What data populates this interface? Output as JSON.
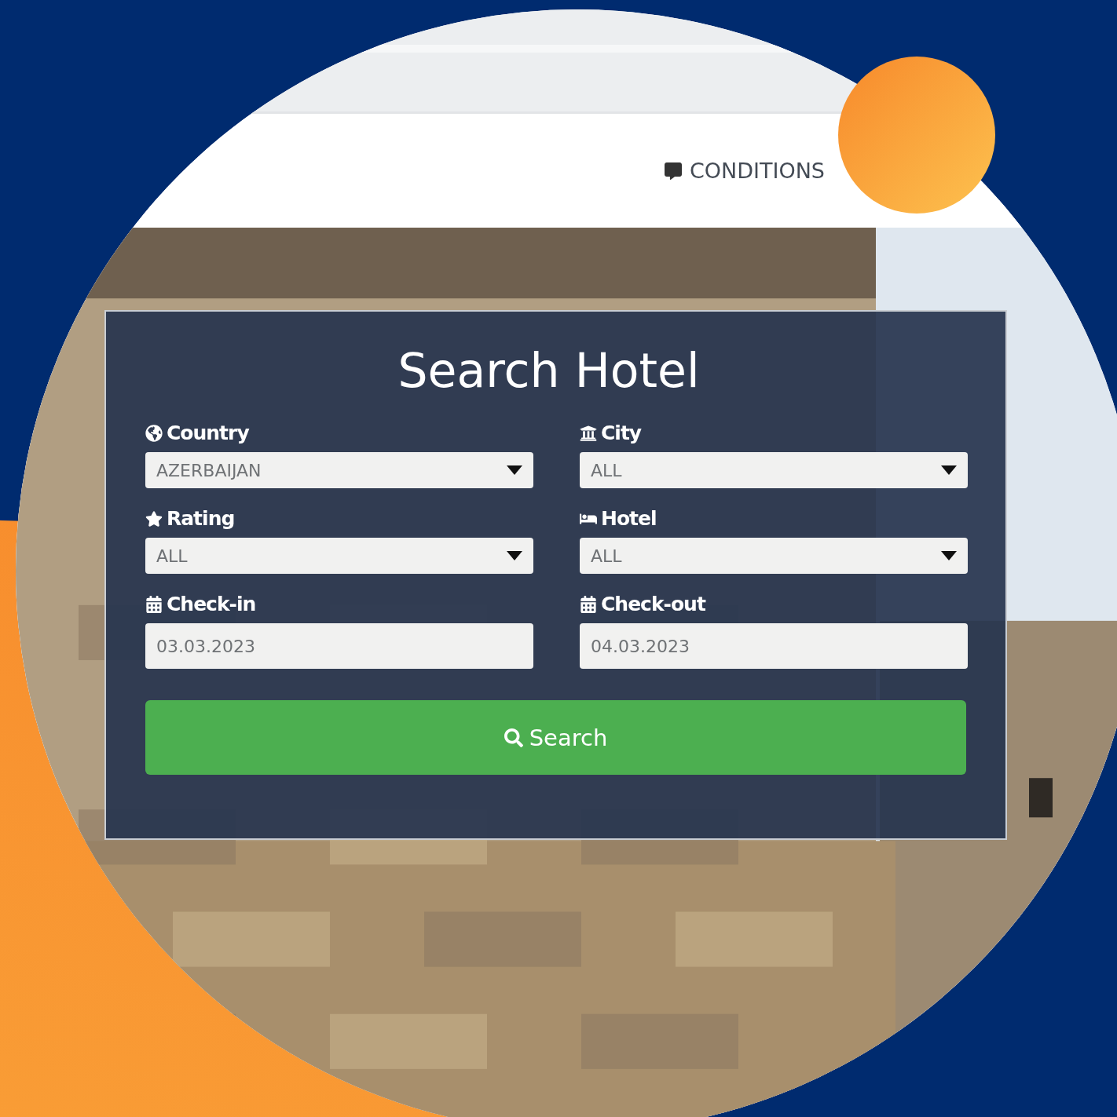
{
  "nav": {
    "link": "CONDITIONS"
  },
  "form": {
    "title": "Search Hotel",
    "fields": [
      {
        "label": "Country",
        "kind": "select",
        "value": "AZERBAIJAN"
      },
      {
        "label": "City",
        "kind": "select",
        "value": "ALL"
      },
      {
        "label": "Rating",
        "kind": "select",
        "value": "ALL"
      },
      {
        "label": "Hotel",
        "kind": "select",
        "value": "ALL"
      },
      {
        "label": "Check-in",
        "kind": "date",
        "value": "03.03.2023"
      },
      {
        "label": "Check-out",
        "kind": "date",
        "value": "04.03.2023"
      }
    ],
    "search_button": "Search"
  }
}
